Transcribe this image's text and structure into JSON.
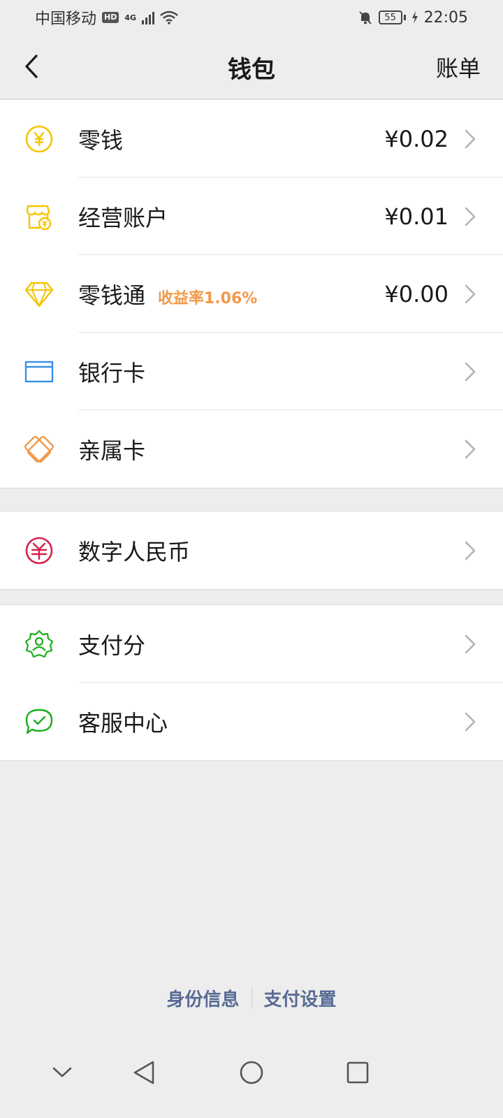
{
  "status_bar": {
    "carrier": "中国移动",
    "hd": "HD",
    "network": "4G",
    "battery": "55",
    "time": "22:05"
  },
  "nav": {
    "title": "钱包",
    "bill_label": "账单"
  },
  "wallet_items": [
    {
      "label": "零钱",
      "value": "¥0.02",
      "icon": "yuan-coin-icon",
      "color": "#f5c400"
    },
    {
      "label": "经营账户",
      "value": "¥0.01",
      "icon": "shop-account-icon",
      "color": "#f5c400"
    },
    {
      "label": "零钱通",
      "tag": "收益率1.06%",
      "value": "¥0.00",
      "icon": "diamond-icon",
      "color": "#f5c400"
    },
    {
      "label": "银行卡",
      "value": "",
      "icon": "bank-card-icon",
      "color": "#3a8ee6"
    },
    {
      "label": "亲属卡",
      "value": "",
      "icon": "family-card-icon",
      "color": "#f2994a"
    }
  ],
  "digital_items": [
    {
      "label": "数字人民币",
      "icon": "digital-rmb-icon",
      "color": "#d6204b"
    }
  ],
  "service_items": [
    {
      "label": "支付分",
      "icon": "pay-score-icon",
      "color": "#1aad19"
    },
    {
      "label": "客服中心",
      "icon": "customer-service-icon",
      "color": "#1aad19"
    }
  ],
  "footer": {
    "identity_label": "身份信息",
    "pay_settings_label": "支付设置"
  },
  "colors": {
    "link": "#576b95",
    "tag": "#f2994a",
    "background": "#ededed"
  }
}
